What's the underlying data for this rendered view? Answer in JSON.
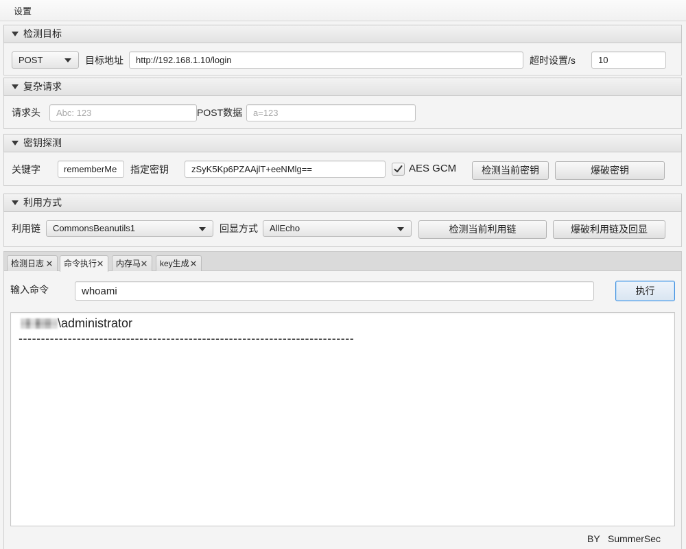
{
  "menu": {
    "items": [
      {
        "label": "设置"
      }
    ]
  },
  "target": {
    "title": "检测目标",
    "method": "POST",
    "url_label": "目标地址",
    "url": "http://192.168.1.10/login",
    "timeout_label": "超时设置/s",
    "timeout": "10"
  },
  "request": {
    "title": "复杂请求",
    "headers_label": "请求头",
    "headers_placeholder": "Abc: 123",
    "post_label": "POST数据",
    "post_placeholder": "a=123"
  },
  "key": {
    "title": "密钥探测",
    "keyword_label": "关键字",
    "keyword": "rememberMe",
    "key_label": "指定密钥",
    "key": "zSyK5Kp6PZAAjlT+eeNMlg==",
    "aes_gcm_label": "AES GCM",
    "aes_gcm_checked": true,
    "check_button": "检测当前密钥",
    "brute_button": "爆破密钥"
  },
  "exploit": {
    "title": "利用方式",
    "chain_label": "利用链",
    "chain": "CommonsBeanutils1",
    "echo_label": "回显方式",
    "echo": "AllEcho",
    "check_button": "检测当前利用链",
    "brute_button": "爆破利用链及回显"
  },
  "tabs": [
    {
      "label": "检测日志",
      "selected": false
    },
    {
      "label": "命令执行",
      "selected": true
    },
    {
      "label": "内存马",
      "selected": false
    },
    {
      "label": "key生成",
      "selected": false
    }
  ],
  "command": {
    "label": "输入命令",
    "value": "whoami",
    "execute_button": "执行",
    "output": {
      "user_suffix": "\\administrator",
      "separator": "---------------------------------------------------------------------------"
    }
  },
  "footer": {
    "by": "BY",
    "author": "SummerSec"
  },
  "icons": {
    "section_toggle": "triangle-down-icon",
    "dropdown": "chevron-down-icon",
    "tab_close": "close-icon",
    "check": "checkmark-icon"
  },
  "colors": {
    "focus_ring": "#3d8ee0"
  }
}
